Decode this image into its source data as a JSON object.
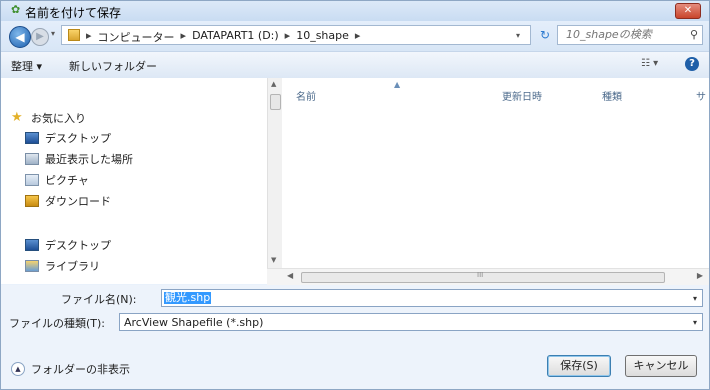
{
  "window": {
    "title": "名前を付けて保存",
    "close_glyph": "✕"
  },
  "navigation": {
    "back_glyph": "◀",
    "forward_glyph": "▶",
    "breadcrumbs": [
      "コンピューター",
      "DATAPART1 (D:)",
      "10_shape"
    ],
    "separator": "▸",
    "refresh_glyph": "↻",
    "search_placeholder": "10_shapeの検索",
    "search_icon": "search-icon"
  },
  "command_bar": {
    "organize_label": "整理 ▾",
    "new_folder_label": "新しいフォルダー",
    "view_label": "☷ ▾",
    "help_glyph": "?"
  },
  "nav_pane": {
    "items": [
      {
        "label": "お気に入り",
        "icon": "star-icon"
      },
      {
        "label": "デスクトップ",
        "icon": "desktop-icon"
      },
      {
        "label": "最近表示した場所",
        "icon": "recent-places-icon"
      },
      {
        "label": "ピクチャ",
        "icon": "pictures-icon"
      },
      {
        "label": "ダウンロード",
        "icon": "downloads-icon"
      },
      {
        "label": "デスクトップ",
        "icon": "desktop-icon"
      },
      {
        "label": "ライブラリ",
        "icon": "library-icon"
      }
    ]
  },
  "file_list": {
    "columns": [
      "名前",
      "更新日時",
      "種類",
      "サ"
    ]
  },
  "form": {
    "filename_label": "ファイル名(N):",
    "filename_value": "観光.shp",
    "filetype_label": "ファイルの種類(T):",
    "filetype_value": "ArcView Shapefile (*.shp)"
  },
  "footer": {
    "hide_folders_label": "フォルダーの非表示",
    "save_label": "保存(S)",
    "cancel_label": "キャンセル"
  }
}
